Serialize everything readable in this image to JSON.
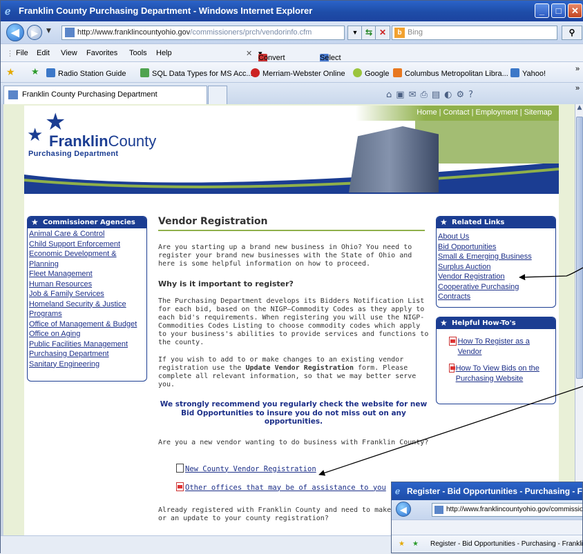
{
  "window": {
    "title": "Franklin County Purchasing Department - Windows Internet Explorer"
  },
  "address_bar": {
    "url_host": "http://www.franklincountyohio.gov",
    "url_path": "/commissioners/prch/vendorinfo.cfm",
    "search_placeholder": "Bing"
  },
  "menu": [
    "File",
    "Edit",
    "View",
    "Favorites",
    "Tools",
    "Help"
  ],
  "menu_tools": {
    "convert": "Convert",
    "select": "Select"
  },
  "favorites": [
    {
      "label": "Radio Station Guide",
      "icon": "ie-page-icon"
    },
    {
      "label": "SQL Data Types for MS Acc...",
      "icon": "sql-icon"
    },
    {
      "label": "Merriam-Webster Online",
      "icon": "mw-icon"
    },
    {
      "label": "Google",
      "icon": "google-icon"
    },
    {
      "label": "Columbus Metropolitan Libra...",
      "icon": "library-icon"
    },
    {
      "label": "Yahoo!",
      "icon": "ie-page-icon"
    }
  ],
  "tab": {
    "label": "Franklin County Purchasing Department"
  },
  "site": {
    "top_links": [
      "Home",
      "Contact",
      "Employment",
      "Sitemap"
    ],
    "logo_franklin": "Franklin",
    "logo_county": "County",
    "logo_sub": "Purchasing Department"
  },
  "left_nav": {
    "title": "Commissioner Agencies",
    "items": [
      "Animal Care & Control",
      "Child Support Enforcement",
      "Economic Development & Planning",
      "Fleet Management",
      "Human Resources",
      "Job & Family Services",
      "Homeland Security & Justice Programs",
      "Office of Management & Budget",
      "Office on Aging",
      "Public Facilities Management",
      "Purchasing Department",
      "Sanitary Engineering"
    ]
  },
  "main": {
    "title": "Vendor Registration",
    "intro": "Are you starting up a brand new business in Ohio? You need to register your brand new businesses with the State of Ohio and here is some helpful information on how to proceed.",
    "why_heading": "Why is it important to register?",
    "why_text": "The Purchasing Department develops its Bidders Notification List for each bid, based on the NIGP–Commodity Codes as they apply to each bid's requirements. When registering you will use the NIGP-Commodities Codes Listing to choose commodity codes which apply to your business's abilities to provide services and functions to the county.",
    "update_pre": "If you wish to add to or make changes to an existing vendor registration use the ",
    "update_bold": "Update Vendor Registration",
    "update_post": " form. Please complete all relevant information, so that we may better serve you.",
    "recommend": "We strongly recommend you regularly check the website for new Bid Opportunities to insure you do not miss out on any opportunities.",
    "new_vendor_q": "Are you a new vendor wanting to do business with Franklin County?",
    "link_new": "New County Vendor Registration",
    "link_other": "Other offices that may be of assistance to you",
    "registered": "Already registered with Franklin County and need to make a change or an update to your county registration?"
  },
  "related_links": {
    "title": "Related Links",
    "items": [
      "About Us",
      "Bid Opportunities",
      "Small & Emerging Business",
      "Surplus Auction",
      "Vendor Registration",
      "Cooperative Purchasing",
      "Contracts"
    ]
  },
  "howto": {
    "title": "Helpful How-To's",
    "items": [
      "How To Register as a Vendor",
      "How To View Bids on the Purchasing Website"
    ]
  },
  "popup": {
    "title": "Register - Bid Opportunities - Purchasing - Frank",
    "url": "http://www.franklincountyohio.gov/commissio",
    "tab": "Register - Bid Opportunities - Purchasing - Franklin"
  }
}
